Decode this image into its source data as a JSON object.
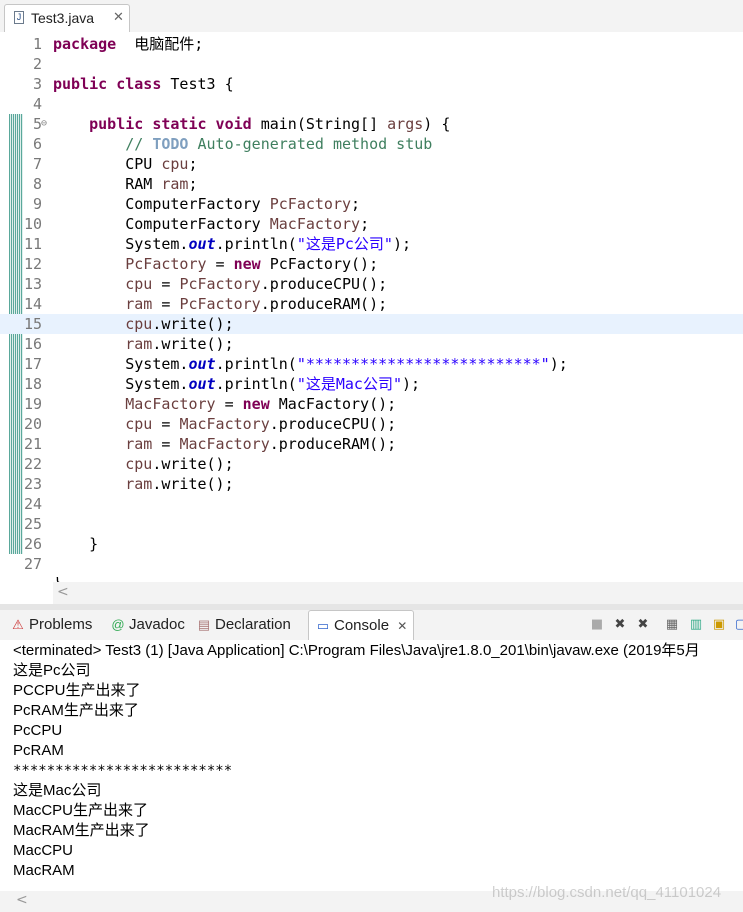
{
  "editor": {
    "tab": {
      "label": "Test3.java",
      "close": "✕"
    },
    "lines": [
      {
        "n": "1",
        "t": [
          [
            "kw",
            "package"
          ],
          [
            "",
            "  电脑配件;"
          ]
        ]
      },
      {
        "n": "2",
        "t": []
      },
      {
        "n": "3",
        "t": [
          [
            "kw",
            "public"
          ],
          [
            "",
            ""
          ],
          [
            "kw",
            " class"
          ],
          [
            "",
            " Test3 {"
          ]
        ]
      },
      {
        "n": "4",
        "t": []
      },
      {
        "n": "5",
        "fold": "⊖",
        "t": [
          [
            "",
            "    "
          ],
          [
            "kw",
            "public static void"
          ],
          [
            "",
            " main(String[] "
          ],
          [
            "var",
            "args"
          ],
          [
            "",
            ") {"
          ]
        ]
      },
      {
        "n": "6",
        "t": [
          [
            "",
            "        "
          ],
          [
            "cm",
            "// "
          ],
          [
            "todo",
            "TODO"
          ],
          [
            "cm",
            " Auto-generated method stub"
          ]
        ]
      },
      {
        "n": "7",
        "t": [
          [
            "",
            "        CPU "
          ],
          [
            "var",
            "cpu"
          ],
          [
            "",
            ";"
          ]
        ]
      },
      {
        "n": "8",
        "t": [
          [
            "",
            "        RAM "
          ],
          [
            "var",
            "ram"
          ],
          [
            "",
            ";"
          ]
        ]
      },
      {
        "n": "9",
        "t": [
          [
            "",
            "        ComputerFactory "
          ],
          [
            "var",
            "PcFactory"
          ],
          [
            "",
            ";"
          ]
        ]
      },
      {
        "n": "10",
        "t": [
          [
            "",
            "        ComputerFactory "
          ],
          [
            "var",
            "MacFactory"
          ],
          [
            "",
            ";"
          ]
        ]
      },
      {
        "n": "11",
        "t": [
          [
            "",
            "        System."
          ],
          [
            "st",
            "out"
          ],
          [
            "",
            ".println("
          ],
          [
            "str",
            "\"这是Pc公司\""
          ],
          [
            "",
            ");"
          ]
        ]
      },
      {
        "n": "12",
        "t": [
          [
            "",
            "        "
          ],
          [
            "var",
            "PcFactory"
          ],
          [
            "",
            " = "
          ],
          [
            "kw",
            "new"
          ],
          [
            "",
            " PcFactory();"
          ]
        ]
      },
      {
        "n": "13",
        "t": [
          [
            "",
            "        "
          ],
          [
            "var",
            "cpu"
          ],
          [
            "",
            " = "
          ],
          [
            "var",
            "PcFactory"
          ],
          [
            "",
            ".produceCPU();"
          ]
        ]
      },
      {
        "n": "14",
        "t": [
          [
            "",
            "        "
          ],
          [
            "var",
            "ram"
          ],
          [
            "",
            " = "
          ],
          [
            "var",
            "PcFactory"
          ],
          [
            "",
            ".produceRAM();"
          ]
        ]
      },
      {
        "n": "15",
        "current": true,
        "t": [
          [
            "",
            "        "
          ],
          [
            "var",
            "cpu"
          ],
          [
            "",
            ".write();"
          ]
        ]
      },
      {
        "n": "16",
        "t": [
          [
            "",
            "        "
          ],
          [
            "var",
            "ram"
          ],
          [
            "",
            ".write();"
          ]
        ]
      },
      {
        "n": "17",
        "t": [
          [
            "",
            "        System."
          ],
          [
            "st",
            "out"
          ],
          [
            "",
            ".println("
          ],
          [
            "str",
            "\"**************************\""
          ],
          [
            "",
            ");"
          ]
        ]
      },
      {
        "n": "18",
        "t": [
          [
            "",
            "        System."
          ],
          [
            "st",
            "out"
          ],
          [
            "",
            ".println("
          ],
          [
            "str",
            "\"这是Mac公司\""
          ],
          [
            "",
            ");"
          ]
        ]
      },
      {
        "n": "19",
        "t": [
          [
            "",
            "        "
          ],
          [
            "var",
            "MacFactory"
          ],
          [
            "",
            " = "
          ],
          [
            "kw",
            "new"
          ],
          [
            "",
            " MacFactory();"
          ]
        ]
      },
      {
        "n": "20",
        "t": [
          [
            "",
            "        "
          ],
          [
            "var",
            "cpu"
          ],
          [
            "",
            " = "
          ],
          [
            "var",
            "MacFactory"
          ],
          [
            "",
            ".produceCPU();"
          ]
        ]
      },
      {
        "n": "21",
        "t": [
          [
            "",
            "        "
          ],
          [
            "var",
            "ram"
          ],
          [
            "",
            " = "
          ],
          [
            "var",
            "MacFactory"
          ],
          [
            "",
            ".produceRAM();"
          ]
        ]
      },
      {
        "n": "22",
        "t": [
          [
            "",
            "        "
          ],
          [
            "var",
            "cpu"
          ],
          [
            "",
            ".write();"
          ]
        ]
      },
      {
        "n": "23",
        "t": [
          [
            "",
            "        "
          ],
          [
            "var",
            "ram"
          ],
          [
            "",
            ".write();"
          ]
        ]
      },
      {
        "n": "24",
        "t": []
      },
      {
        "n": "25",
        "t": []
      },
      {
        "n": "26",
        "t": [
          [
            "",
            "    }"
          ]
        ]
      },
      {
        "n": "27",
        "t": []
      }
    ],
    "cut_line": "}",
    "scroll_left": "<"
  },
  "views": {
    "problems": "Problems",
    "javadoc": "Javadoc",
    "declaration": "Declaration",
    "console": "Console",
    "close": "✕",
    "toolbar_icons": [
      "terminate-icon",
      "remove-launch-icon",
      "remove-all-icon",
      "scroll-lock-icon",
      "show-console-icon",
      "pin-icon",
      "open-console-icon"
    ]
  },
  "console": {
    "header": "<terminated> Test3 (1) [Java Application] C:\\Program Files\\Java\\jre1.8.0_201\\bin\\javaw.exe (2019年5月",
    "output": [
      "这是Pc公司",
      "PCCPU生产出来了",
      "PcRAM生产出来了",
      "PcCPU",
      "PcRAM",
      "**************************",
      "这是Mac公司",
      "MacCPU生产出来了",
      "MacRAM生产出来了",
      "MacCPU",
      "MacRAM"
    ],
    "scroll_left": "<"
  },
  "watermark": "https://blog.csdn.net/qq_41101024"
}
